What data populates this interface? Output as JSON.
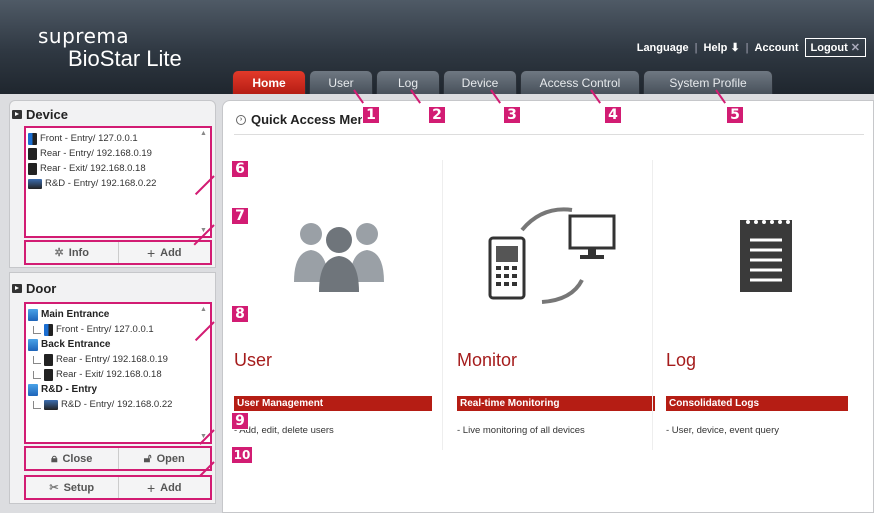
{
  "brand": {
    "logo": "suprema",
    "product": "BioStar Lite"
  },
  "toplinks": {
    "language": "Language",
    "help": "Help",
    "account": "Account",
    "logout": "Logout"
  },
  "tabs": [
    "Home",
    "User",
    "Log",
    "Device",
    "Access Control",
    "System Profile"
  ],
  "sidebar": {
    "device": {
      "title": "Device",
      "items": [
        "Front - Entry/ 127.0.0.1",
        "Rear - Entry/ 192.168.0.19",
        "Rear - Exit/ 192.168.0.18",
        "R&D - Entry/ 192.168.0.22"
      ],
      "buttons": {
        "info": "Info",
        "add": "Add"
      }
    },
    "door": {
      "title": "Door",
      "groups": [
        {
          "name": "Main Entrance",
          "items": [
            "Front - Entry/ 127.0.0.1"
          ]
        },
        {
          "name": "Back Entrance",
          "items": [
            "Rear - Entry/ 192.168.0.19",
            "Rear - Exit/ 192.168.0.18"
          ]
        },
        {
          "name": "R&D - Entry",
          "items": [
            "R&D - Entry/ 192.168.0.22"
          ]
        }
      ],
      "buttons": {
        "close": "Close",
        "open": "Open",
        "setup": "Setup",
        "add": "Add"
      }
    }
  },
  "main": {
    "title": "Quick Access Menu",
    "cards": [
      {
        "title": "User",
        "bar": "User Management",
        "desc": "- Add, edit, delete users",
        "icon": "users-icon"
      },
      {
        "title": "Monitor",
        "bar": "Real-time Monitoring",
        "desc": "- Live monitoring of all devices",
        "icon": "monitor-icon"
      },
      {
        "title": "Log",
        "bar": "Consolidated Logs",
        "desc": "- User, device, event query",
        "icon": "log-icon"
      }
    ]
  },
  "callouts": [
    "1",
    "2",
    "3",
    "4",
    "5",
    "6",
    "7",
    "8",
    "9",
    "10"
  ],
  "colors": {
    "accent": "#b51d14",
    "callout": "#d21c73",
    "header": "#2f3842"
  }
}
